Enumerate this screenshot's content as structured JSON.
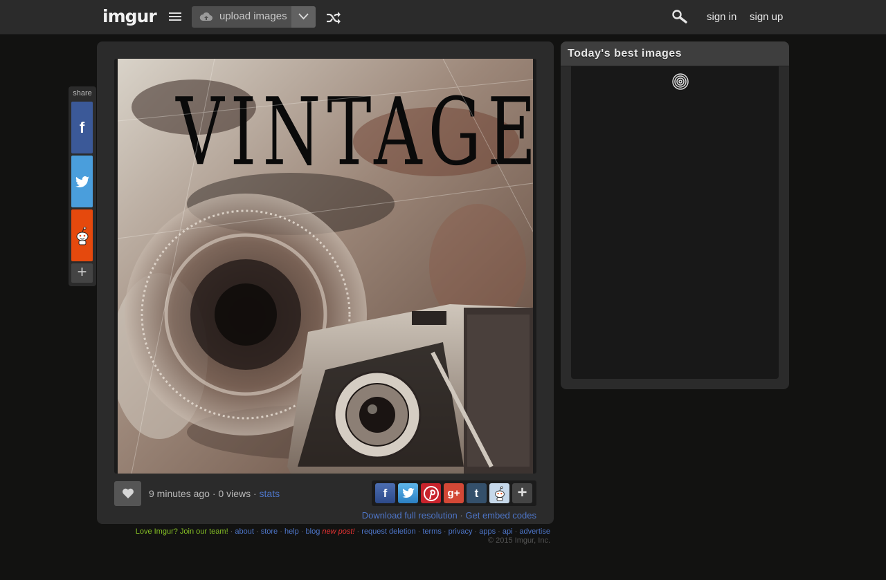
{
  "header": {
    "logo": "imgur",
    "upload_label": "upload images",
    "signin_label": "sign in",
    "signup_label": "sign up"
  },
  "share": {
    "title": "share",
    "facebook_label": "f",
    "more_label": "+"
  },
  "image": {
    "headline": "VINTAGE",
    "time_ago": "9 minutes ago",
    "views": "0 views",
    "stats_label": "stats",
    "download_label": "Download full resolution",
    "embed_label": "Get embed codes"
  },
  "social": {
    "facebook": "f",
    "google": "g+",
    "tumblr": "t",
    "more": "+"
  },
  "footer": {
    "join": "Love Imgur? Join our team!",
    "about": "about",
    "store": "store",
    "help": "help",
    "blog": "blog",
    "new_post": "new post!",
    "request_deletion": "request deletion",
    "terms": "terms",
    "privacy": "privacy",
    "apps": "apps",
    "api": "api",
    "advertise": "advertise",
    "copyright": "© 2015 Imgur, Inc."
  },
  "sidebar": {
    "best_title": "Today's best images"
  },
  "colors": {
    "background": "#121211",
    "panel": "#2b2b2b",
    "link": "#4e76c9",
    "join": "#85bf25",
    "new_post": "#ee3333"
  }
}
